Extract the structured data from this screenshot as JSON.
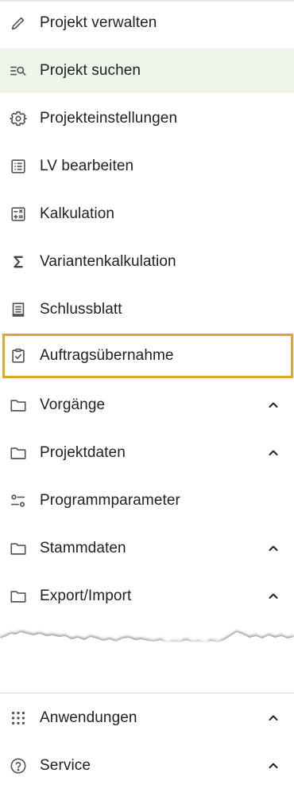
{
  "nav": {
    "items": [
      {
        "label": "Projekt verwalten",
        "icon": "pencil-icon"
      },
      {
        "label": "Projekt suchen",
        "icon": "list-search-icon"
      },
      {
        "label": "Projekteinstellungen",
        "icon": "gear-icon"
      },
      {
        "label": "LV bearbeiten",
        "icon": "list-doc-icon"
      },
      {
        "label": "Kalkulation",
        "icon": "calculator-icon"
      },
      {
        "label": "Variantenkalkulation",
        "icon": "sigma-icon"
      },
      {
        "label": "Schlussblatt",
        "icon": "receipt-icon"
      },
      {
        "label": "Auftragsübernahme",
        "icon": "clipboard-check-icon"
      },
      {
        "label": "Vorgänge",
        "icon": "folder-icon"
      },
      {
        "label": "Projektdaten",
        "icon": "folder-icon"
      },
      {
        "label": "Programmparameter",
        "icon": "sliders-icon"
      },
      {
        "label": "Stammdaten",
        "icon": "folder-icon"
      },
      {
        "label": "Export/Import",
        "icon": "folder-icon"
      }
    ],
    "active_item": "Projekt suchen",
    "highlighted_item": "Auftragsübernahme"
  },
  "bottom": {
    "items": [
      {
        "label": "Anwendungen",
        "icon": "apps-grid-icon"
      },
      {
        "label": "Service",
        "icon": "help-circle-icon"
      }
    ]
  },
  "colors": {
    "active_bg": "#eef6ea",
    "highlight_border": "#e2a52b",
    "text": "#212121",
    "icon": "#555555"
  }
}
